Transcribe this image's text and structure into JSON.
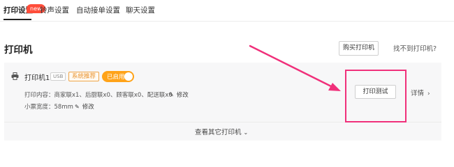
{
  "tabs": [
    {
      "label": "打印设置",
      "active": true,
      "badge": "new"
    },
    {
      "label": "铃声设置",
      "active": false
    },
    {
      "label": "自动接单设置",
      "active": false
    },
    {
      "label": "聊天设置",
      "active": false
    }
  ],
  "section": {
    "title": "打印机",
    "buy_button": "购买打印机",
    "cant_find_link": "找不到打印机?"
  },
  "printer": {
    "icon": "printer-icon",
    "name": "打印机1",
    "connection_tag": "USB",
    "recommend_tag": "系统推荐",
    "status": "已启用",
    "status_enabled": true,
    "content_line": "打印内容：商家联x1、后厨联x0、顾客联x0、配送联x0",
    "width_line": "小票宽度：58mm",
    "edit_label": "修改",
    "test_button": "打印测试",
    "details_link": "详情"
  },
  "footer": {
    "view_more": "查看其它打印机"
  },
  "annotation": {
    "highlight_color": "#f0307a"
  }
}
